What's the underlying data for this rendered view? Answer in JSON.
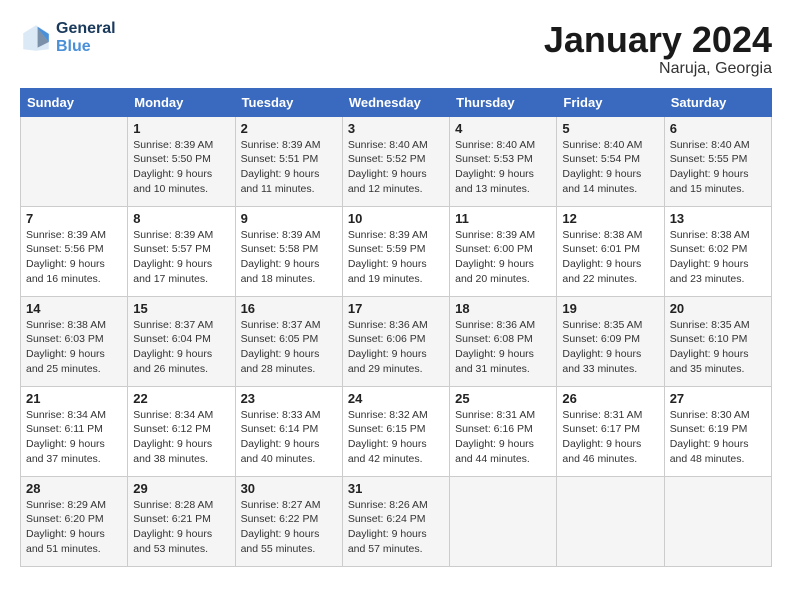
{
  "logo": {
    "line1": "General",
    "line2": "Blue"
  },
  "title": "January 2024",
  "location": "Naruja, Georgia",
  "days_of_week": [
    "Sunday",
    "Monday",
    "Tuesday",
    "Wednesday",
    "Thursday",
    "Friday",
    "Saturday"
  ],
  "weeks": [
    [
      {
        "num": "",
        "info": ""
      },
      {
        "num": "1",
        "info": "Sunrise: 8:39 AM\nSunset: 5:50 PM\nDaylight: 9 hours\nand 10 minutes."
      },
      {
        "num": "2",
        "info": "Sunrise: 8:39 AM\nSunset: 5:51 PM\nDaylight: 9 hours\nand 11 minutes."
      },
      {
        "num": "3",
        "info": "Sunrise: 8:40 AM\nSunset: 5:52 PM\nDaylight: 9 hours\nand 12 minutes."
      },
      {
        "num": "4",
        "info": "Sunrise: 8:40 AM\nSunset: 5:53 PM\nDaylight: 9 hours\nand 13 minutes."
      },
      {
        "num": "5",
        "info": "Sunrise: 8:40 AM\nSunset: 5:54 PM\nDaylight: 9 hours\nand 14 minutes."
      },
      {
        "num": "6",
        "info": "Sunrise: 8:40 AM\nSunset: 5:55 PM\nDaylight: 9 hours\nand 15 minutes."
      }
    ],
    [
      {
        "num": "7",
        "info": "Sunrise: 8:39 AM\nSunset: 5:56 PM\nDaylight: 9 hours\nand 16 minutes."
      },
      {
        "num": "8",
        "info": "Sunrise: 8:39 AM\nSunset: 5:57 PM\nDaylight: 9 hours\nand 17 minutes."
      },
      {
        "num": "9",
        "info": "Sunrise: 8:39 AM\nSunset: 5:58 PM\nDaylight: 9 hours\nand 18 minutes."
      },
      {
        "num": "10",
        "info": "Sunrise: 8:39 AM\nSunset: 5:59 PM\nDaylight: 9 hours\nand 19 minutes."
      },
      {
        "num": "11",
        "info": "Sunrise: 8:39 AM\nSunset: 6:00 PM\nDaylight: 9 hours\nand 20 minutes."
      },
      {
        "num": "12",
        "info": "Sunrise: 8:38 AM\nSunset: 6:01 PM\nDaylight: 9 hours\nand 22 minutes."
      },
      {
        "num": "13",
        "info": "Sunrise: 8:38 AM\nSunset: 6:02 PM\nDaylight: 9 hours\nand 23 minutes."
      }
    ],
    [
      {
        "num": "14",
        "info": "Sunrise: 8:38 AM\nSunset: 6:03 PM\nDaylight: 9 hours\nand 25 minutes."
      },
      {
        "num": "15",
        "info": "Sunrise: 8:37 AM\nSunset: 6:04 PM\nDaylight: 9 hours\nand 26 minutes."
      },
      {
        "num": "16",
        "info": "Sunrise: 8:37 AM\nSunset: 6:05 PM\nDaylight: 9 hours\nand 28 minutes."
      },
      {
        "num": "17",
        "info": "Sunrise: 8:36 AM\nSunset: 6:06 PM\nDaylight: 9 hours\nand 29 minutes."
      },
      {
        "num": "18",
        "info": "Sunrise: 8:36 AM\nSunset: 6:08 PM\nDaylight: 9 hours\nand 31 minutes."
      },
      {
        "num": "19",
        "info": "Sunrise: 8:35 AM\nSunset: 6:09 PM\nDaylight: 9 hours\nand 33 minutes."
      },
      {
        "num": "20",
        "info": "Sunrise: 8:35 AM\nSunset: 6:10 PM\nDaylight: 9 hours\nand 35 minutes."
      }
    ],
    [
      {
        "num": "21",
        "info": "Sunrise: 8:34 AM\nSunset: 6:11 PM\nDaylight: 9 hours\nand 37 minutes."
      },
      {
        "num": "22",
        "info": "Sunrise: 8:34 AM\nSunset: 6:12 PM\nDaylight: 9 hours\nand 38 minutes."
      },
      {
        "num": "23",
        "info": "Sunrise: 8:33 AM\nSunset: 6:14 PM\nDaylight: 9 hours\nand 40 minutes."
      },
      {
        "num": "24",
        "info": "Sunrise: 8:32 AM\nSunset: 6:15 PM\nDaylight: 9 hours\nand 42 minutes."
      },
      {
        "num": "25",
        "info": "Sunrise: 8:31 AM\nSunset: 6:16 PM\nDaylight: 9 hours\nand 44 minutes."
      },
      {
        "num": "26",
        "info": "Sunrise: 8:31 AM\nSunset: 6:17 PM\nDaylight: 9 hours\nand 46 minutes."
      },
      {
        "num": "27",
        "info": "Sunrise: 8:30 AM\nSunset: 6:19 PM\nDaylight: 9 hours\nand 48 minutes."
      }
    ],
    [
      {
        "num": "28",
        "info": "Sunrise: 8:29 AM\nSunset: 6:20 PM\nDaylight: 9 hours\nand 51 minutes."
      },
      {
        "num": "29",
        "info": "Sunrise: 8:28 AM\nSunset: 6:21 PM\nDaylight: 9 hours\nand 53 minutes."
      },
      {
        "num": "30",
        "info": "Sunrise: 8:27 AM\nSunset: 6:22 PM\nDaylight: 9 hours\nand 55 minutes."
      },
      {
        "num": "31",
        "info": "Sunrise: 8:26 AM\nSunset: 6:24 PM\nDaylight: 9 hours\nand 57 minutes."
      },
      {
        "num": "",
        "info": ""
      },
      {
        "num": "",
        "info": ""
      },
      {
        "num": "",
        "info": ""
      }
    ]
  ]
}
